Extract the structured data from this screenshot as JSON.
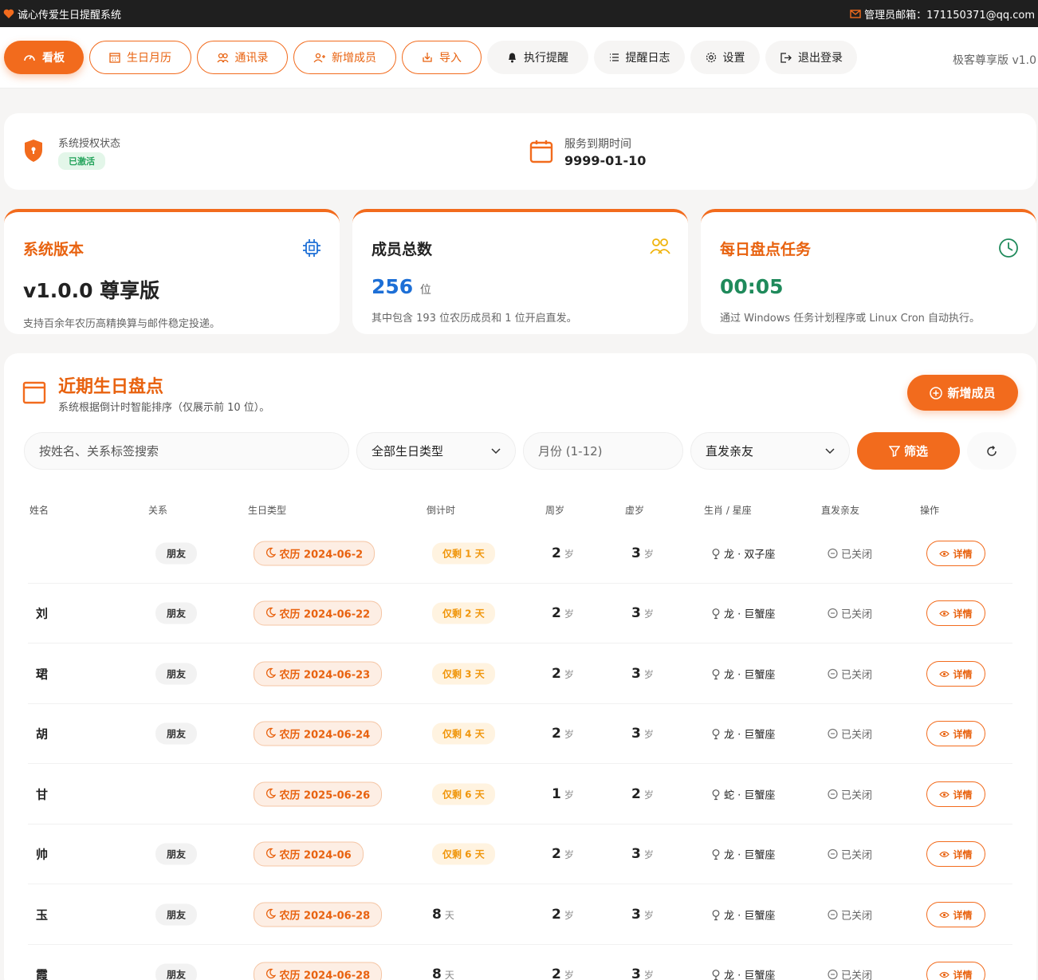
{
  "topbar": {
    "title": "诚心传爱生日提醒系统",
    "email_label": "管理员邮箱：171150371@qq.com"
  },
  "nav": [
    {
      "label": "看板",
      "icon": "dashboard-icon"
    },
    {
      "label": "生日月历",
      "icon": "calendar-icon"
    },
    {
      "label": "通讯录",
      "icon": "contacts-icon"
    },
    {
      "label": "新增成员",
      "icon": "add-user-icon"
    },
    {
      "label": "导入",
      "icon": "import-icon"
    },
    {
      "label": "执行提醒",
      "icon": "bell-icon"
    },
    {
      "label": "提醒日志",
      "icon": "list-icon"
    },
    {
      "label": "设置",
      "icon": "gear-icon"
    },
    {
      "label": "退出登录",
      "icon": "logout-icon"
    }
  ],
  "version_label": "极客尊享版 v1.0",
  "auth": {
    "status_label": "系统授权状态",
    "status_badge": "已激活",
    "expire_label": "服务到期时间",
    "expire_value": "9999-01-10"
  },
  "stats": [
    {
      "title": "系统版本",
      "value": "v1.0.0 尊享版",
      "desc": "支持百余年农历高精换算与邮件稳定投递。",
      "icon": "chip-icon"
    },
    {
      "title": "成员总数",
      "value": "256",
      "unit": "位",
      "desc": "其中包含 193 位农历成员和 1 位开启直发。",
      "icon": "users-icon"
    },
    {
      "title": "每日盘点任务",
      "value": "00:05",
      "desc": "通过 Windows 任务计划程序或 Linux Cron 自动执行。",
      "icon": "clock-icon"
    }
  ],
  "section": {
    "title": "近期生日盘点",
    "subtitle": "系统根据倒计时智能排序（仅展示前 10 位）。",
    "add_button": "新增成员"
  },
  "filters": {
    "search_placeholder": "按姓名、关系标签搜索",
    "type_select": "全部生日类型",
    "month_placeholder": "月份 (1-12)",
    "direct_select": "直发亲友",
    "filter_button": "筛选"
  },
  "table": {
    "headers": [
      "姓名",
      "关系",
      "生日类型",
      "倒计时",
      "周岁",
      "虚岁",
      "生肖 / 星座",
      "直发亲友",
      "操作"
    ],
    "rows": [
      {
        "name": "",
        "relation": "朋友",
        "btype": "农历 2024-06-2",
        "countdown": "仅剩 1 天",
        "age": "2",
        "vage": "3",
        "zodiac": "龙 · 双子座",
        "direct": "已关闭",
        "action": "详情"
      },
      {
        "name": "刘",
        "relation": "朋友",
        "btype": "农历 2024-06-22",
        "countdown": "仅剩 2 天",
        "age": "2",
        "vage": "3",
        "zodiac": "龙 · 巨蟹座",
        "direct": "已关闭",
        "action": "详情"
      },
      {
        "name": "珺",
        "relation": "朋友",
        "btype": "农历 2024-06-23",
        "countdown": "仅剩 3 天",
        "age": "2",
        "vage": "3",
        "zodiac": "龙 · 巨蟹座",
        "direct": "已关闭",
        "action": "详情"
      },
      {
        "name": "胡",
        "relation": "朋友",
        "btype": "农历 2024-06-24",
        "countdown": "仅剩 4 天",
        "age": "2",
        "vage": "3",
        "zodiac": "龙 · 巨蟹座",
        "direct": "已关闭",
        "action": "详情"
      },
      {
        "name": "甘",
        "relation": "",
        "btype": "农历 2025-06-26",
        "countdown": "仅剩 6 天",
        "age": "1",
        "vage": "2",
        "zodiac": "蛇 · 巨蟹座",
        "direct": "已关闭",
        "action": "详情"
      },
      {
        "name": "帅",
        "relation": "朋友",
        "btype": "农历 2024-06",
        "countdown": "仅剩 6 天",
        "age": "2",
        "vage": "3",
        "zodiac": "龙 · 巨蟹座",
        "direct": "已关闭",
        "action": "详情"
      },
      {
        "name": "玉",
        "relation": "朋友",
        "btype": "农历 2024-06-28",
        "countdown_num": "8",
        "countdown_unit": "天",
        "age": "2",
        "vage": "3",
        "zodiac": "龙 · 巨蟹座",
        "direct": "已关闭",
        "action": "详情"
      },
      {
        "name": "霞",
        "relation": "朋友",
        "btype": "农历 2024-06-28",
        "countdown_num": "8",
        "countdown_unit": "天",
        "age": "2",
        "vage": "3",
        "zodiac": "龙 · 巨蟹座",
        "direct": "已关闭",
        "action": "详情"
      }
    ],
    "age_unit": "岁"
  },
  "colors": {
    "accent": "#f26b1d",
    "blue": "#1d6fd6",
    "green": "#1f8a5b",
    "badge_green": "#22a35a"
  }
}
